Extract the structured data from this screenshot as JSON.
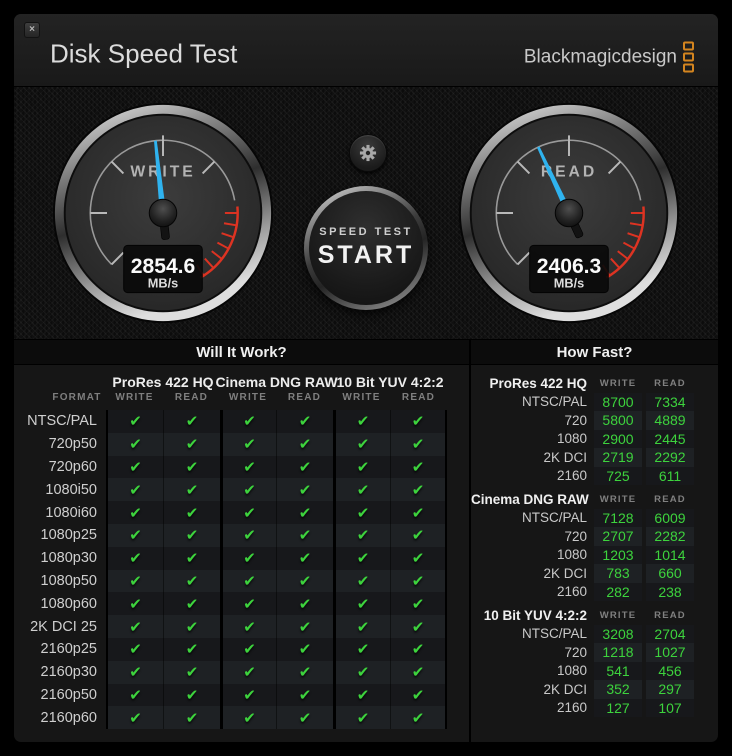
{
  "window": {
    "title": "Disk Speed Test",
    "close": "×"
  },
  "brand": {
    "text": "Blackmagicdesign"
  },
  "gauges": {
    "write": {
      "label": "WRITE",
      "value": "2854.6",
      "unit": "MB/s",
      "needle_deg": -6
    },
    "read": {
      "label": "READ",
      "value": "2406.3",
      "unit": "MB/s",
      "needle_deg": -25
    }
  },
  "start_button": {
    "line1": "SPEED TEST",
    "line2": "START"
  },
  "will_it_work": {
    "title": "Will It Work?",
    "format_label": "FORMAT",
    "write_label": "WRITE",
    "read_label": "READ",
    "check_icon": "✔",
    "codecs": [
      "ProRes 422 HQ",
      "Cinema DNG RAW",
      "10 Bit YUV 4:2:2"
    ],
    "rows": [
      {
        "format": "NTSC/PAL",
        "checks": [
          true,
          true,
          true,
          true,
          true,
          true
        ]
      },
      {
        "format": "720p50",
        "checks": [
          true,
          true,
          true,
          true,
          true,
          true
        ]
      },
      {
        "format": "720p60",
        "checks": [
          true,
          true,
          true,
          true,
          true,
          true
        ]
      },
      {
        "format": "1080i50",
        "checks": [
          true,
          true,
          true,
          true,
          true,
          true
        ]
      },
      {
        "format": "1080i60",
        "checks": [
          true,
          true,
          true,
          true,
          true,
          true
        ]
      },
      {
        "format": "1080p25",
        "checks": [
          true,
          true,
          true,
          true,
          true,
          true
        ]
      },
      {
        "format": "1080p30",
        "checks": [
          true,
          true,
          true,
          true,
          true,
          true
        ]
      },
      {
        "format": "1080p50",
        "checks": [
          true,
          true,
          true,
          true,
          true,
          true
        ]
      },
      {
        "format": "1080p60",
        "checks": [
          true,
          true,
          true,
          true,
          true,
          true
        ]
      },
      {
        "format": "2K DCI 25",
        "checks": [
          true,
          true,
          true,
          true,
          true,
          true
        ]
      },
      {
        "format": "2160p25",
        "checks": [
          true,
          true,
          true,
          true,
          true,
          true
        ]
      },
      {
        "format": "2160p30",
        "checks": [
          true,
          true,
          true,
          true,
          true,
          true
        ]
      },
      {
        "format": "2160p50",
        "checks": [
          true,
          true,
          true,
          true,
          true,
          true
        ]
      },
      {
        "format": "2160p60",
        "checks": [
          true,
          true,
          true,
          true,
          true,
          true
        ]
      }
    ]
  },
  "how_fast": {
    "title": "How Fast?",
    "write_label": "WRITE",
    "read_label": "READ",
    "sections": [
      {
        "codec": "ProRes 422 HQ",
        "rows": [
          [
            "NTSC/PAL",
            8700,
            7334
          ],
          [
            "720",
            5800,
            4889
          ],
          [
            "1080",
            2900,
            2445
          ],
          [
            "2K DCI",
            2719,
            2292
          ],
          [
            "2160",
            725,
            611
          ]
        ]
      },
      {
        "codec": "Cinema DNG RAW",
        "rows": [
          [
            "NTSC/PAL",
            7128,
            6009
          ],
          [
            "720",
            2707,
            2282
          ],
          [
            "1080",
            1203,
            1014
          ],
          [
            "2K DCI",
            783,
            660
          ],
          [
            "2160",
            282,
            238
          ]
        ]
      },
      {
        "codec": "10 Bit YUV 4:2:2",
        "rows": [
          [
            "NTSC/PAL",
            3208,
            2704
          ],
          [
            "720",
            1218,
            1027
          ],
          [
            "1080",
            541,
            456
          ],
          [
            "2K DCI",
            352,
            297
          ],
          [
            "2160",
            127,
            107
          ]
        ]
      }
    ]
  },
  "colors": {
    "accent_orange": "#d4851f",
    "check_green": "#3dd33d",
    "needle_blue": "#2fb3ef",
    "red_zone": "#dd3322"
  }
}
